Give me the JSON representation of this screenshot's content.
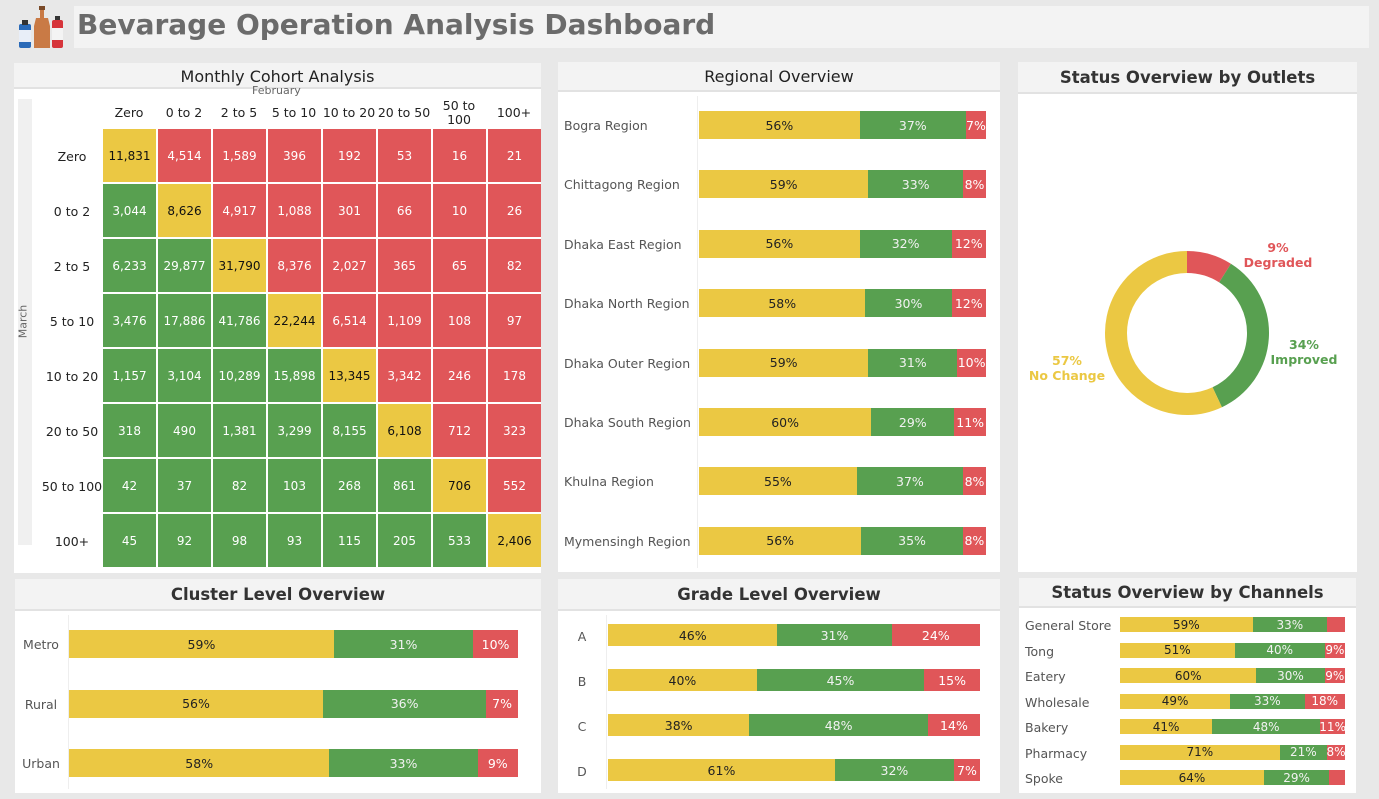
{
  "header": {
    "title": "Bevarage Operation Analysis Dashboard"
  },
  "colors": {
    "no_change": "#ebc843",
    "improved": "#58a050",
    "degraded": "#e05659"
  },
  "cohort": {
    "title": "Monthly Cohort Analysis",
    "col_axis": "February",
    "row_axis": "March",
    "cols": [
      "Zero",
      "0 to 2",
      "2 to 5",
      "5 to 10",
      "10 to 20",
      "20 to 50",
      "50 to 100",
      "100+"
    ],
    "rows": [
      "Zero",
      "0 to 2",
      "2 to 5",
      "5 to 10",
      "10 to 20",
      "20 to 50",
      "50 to 100",
      "100+"
    ],
    "values": [
      [
        "11,831",
        "4,514",
        "1,589",
        "396",
        "192",
        "53",
        "16",
        "21"
      ],
      [
        "3,044",
        "8,626",
        "4,917",
        "1,088",
        "301",
        "66",
        "10",
        "26"
      ],
      [
        "6,233",
        "29,877",
        "31,790",
        "8,376",
        "2,027",
        "365",
        "65",
        "82"
      ],
      [
        "3,476",
        "17,886",
        "41,786",
        "22,244",
        "6,514",
        "1,109",
        "108",
        "97"
      ],
      [
        "1,157",
        "3,104",
        "10,289",
        "15,898",
        "13,345",
        "3,342",
        "246",
        "178"
      ],
      [
        "318",
        "490",
        "1,381",
        "3,299",
        "8,155",
        "6,108",
        "712",
        "323"
      ],
      [
        "42",
        "37",
        "82",
        "103",
        "268",
        "861",
        "706",
        "552"
      ],
      [
        "45",
        "92",
        "98",
        "93",
        "115",
        "205",
        "533",
        "2,406"
      ]
    ]
  },
  "chart_data": [
    {
      "type": "bar",
      "title": "Regional Overview",
      "categories": [
        "Bogra Region",
        "Chittagong Region",
        "Dhaka East Region",
        "Dhaka North Region",
        "Dhaka Outer Region",
        "Dhaka South Region",
        "Khulna Region",
        "Mymensingh Region"
      ],
      "series": [
        {
          "values": [
            56,
            59,
            56,
            58,
            59,
            60,
            55,
            56
          ]
        },
        {
          "values": [
            37,
            33,
            32,
            30,
            31,
            29,
            37,
            35
          ]
        },
        {
          "values": [
            7,
            8,
            12,
            12,
            10,
            11,
            8,
            8
          ]
        }
      ]
    },
    {
      "type": "pie",
      "title": "Status Overview by Outlets",
      "categories": [
        "No Change",
        "Improved",
        "Degraded"
      ],
      "values": [
        57,
        34,
        9
      ]
    },
    {
      "type": "bar",
      "title": "Cluster Level Overview",
      "categories": [
        "Metro",
        "Rural",
        "Urban"
      ],
      "series": [
        {
          "values": [
            59,
            56,
            58
          ]
        },
        {
          "values": [
            31,
            36,
            33
          ]
        },
        {
          "values": [
            10,
            7,
            9
          ]
        }
      ]
    },
    {
      "type": "bar",
      "title": "Grade Level Overview",
      "categories": [
        "A",
        "B",
        "C",
        "D"
      ],
      "series": [
        {
          "values": [
            46,
            40,
            38,
            61
          ]
        },
        {
          "values": [
            31,
            45,
            48,
            32
          ]
        },
        {
          "values": [
            24,
            15,
            14,
            7
          ]
        }
      ]
    },
    {
      "type": "bar",
      "title": "Status Overview by Channels",
      "categories": [
        "General Store",
        "Tong",
        "Eatery",
        "Wholesale",
        "Bakery",
        "Pharmacy",
        "Spoke"
      ],
      "series": [
        {
          "values": [
            59,
            51,
            60,
            49,
            41,
            71,
            64
          ]
        },
        {
          "values": [
            33,
            40,
            30,
            33,
            48,
            21,
            29
          ]
        },
        {
          "values": [
            8,
            9,
            9,
            18,
            11,
            8,
            7
          ]
        }
      ],
      "hidden_labels": [
        "General Store:2",
        "Spoke:2"
      ]
    }
  ]
}
